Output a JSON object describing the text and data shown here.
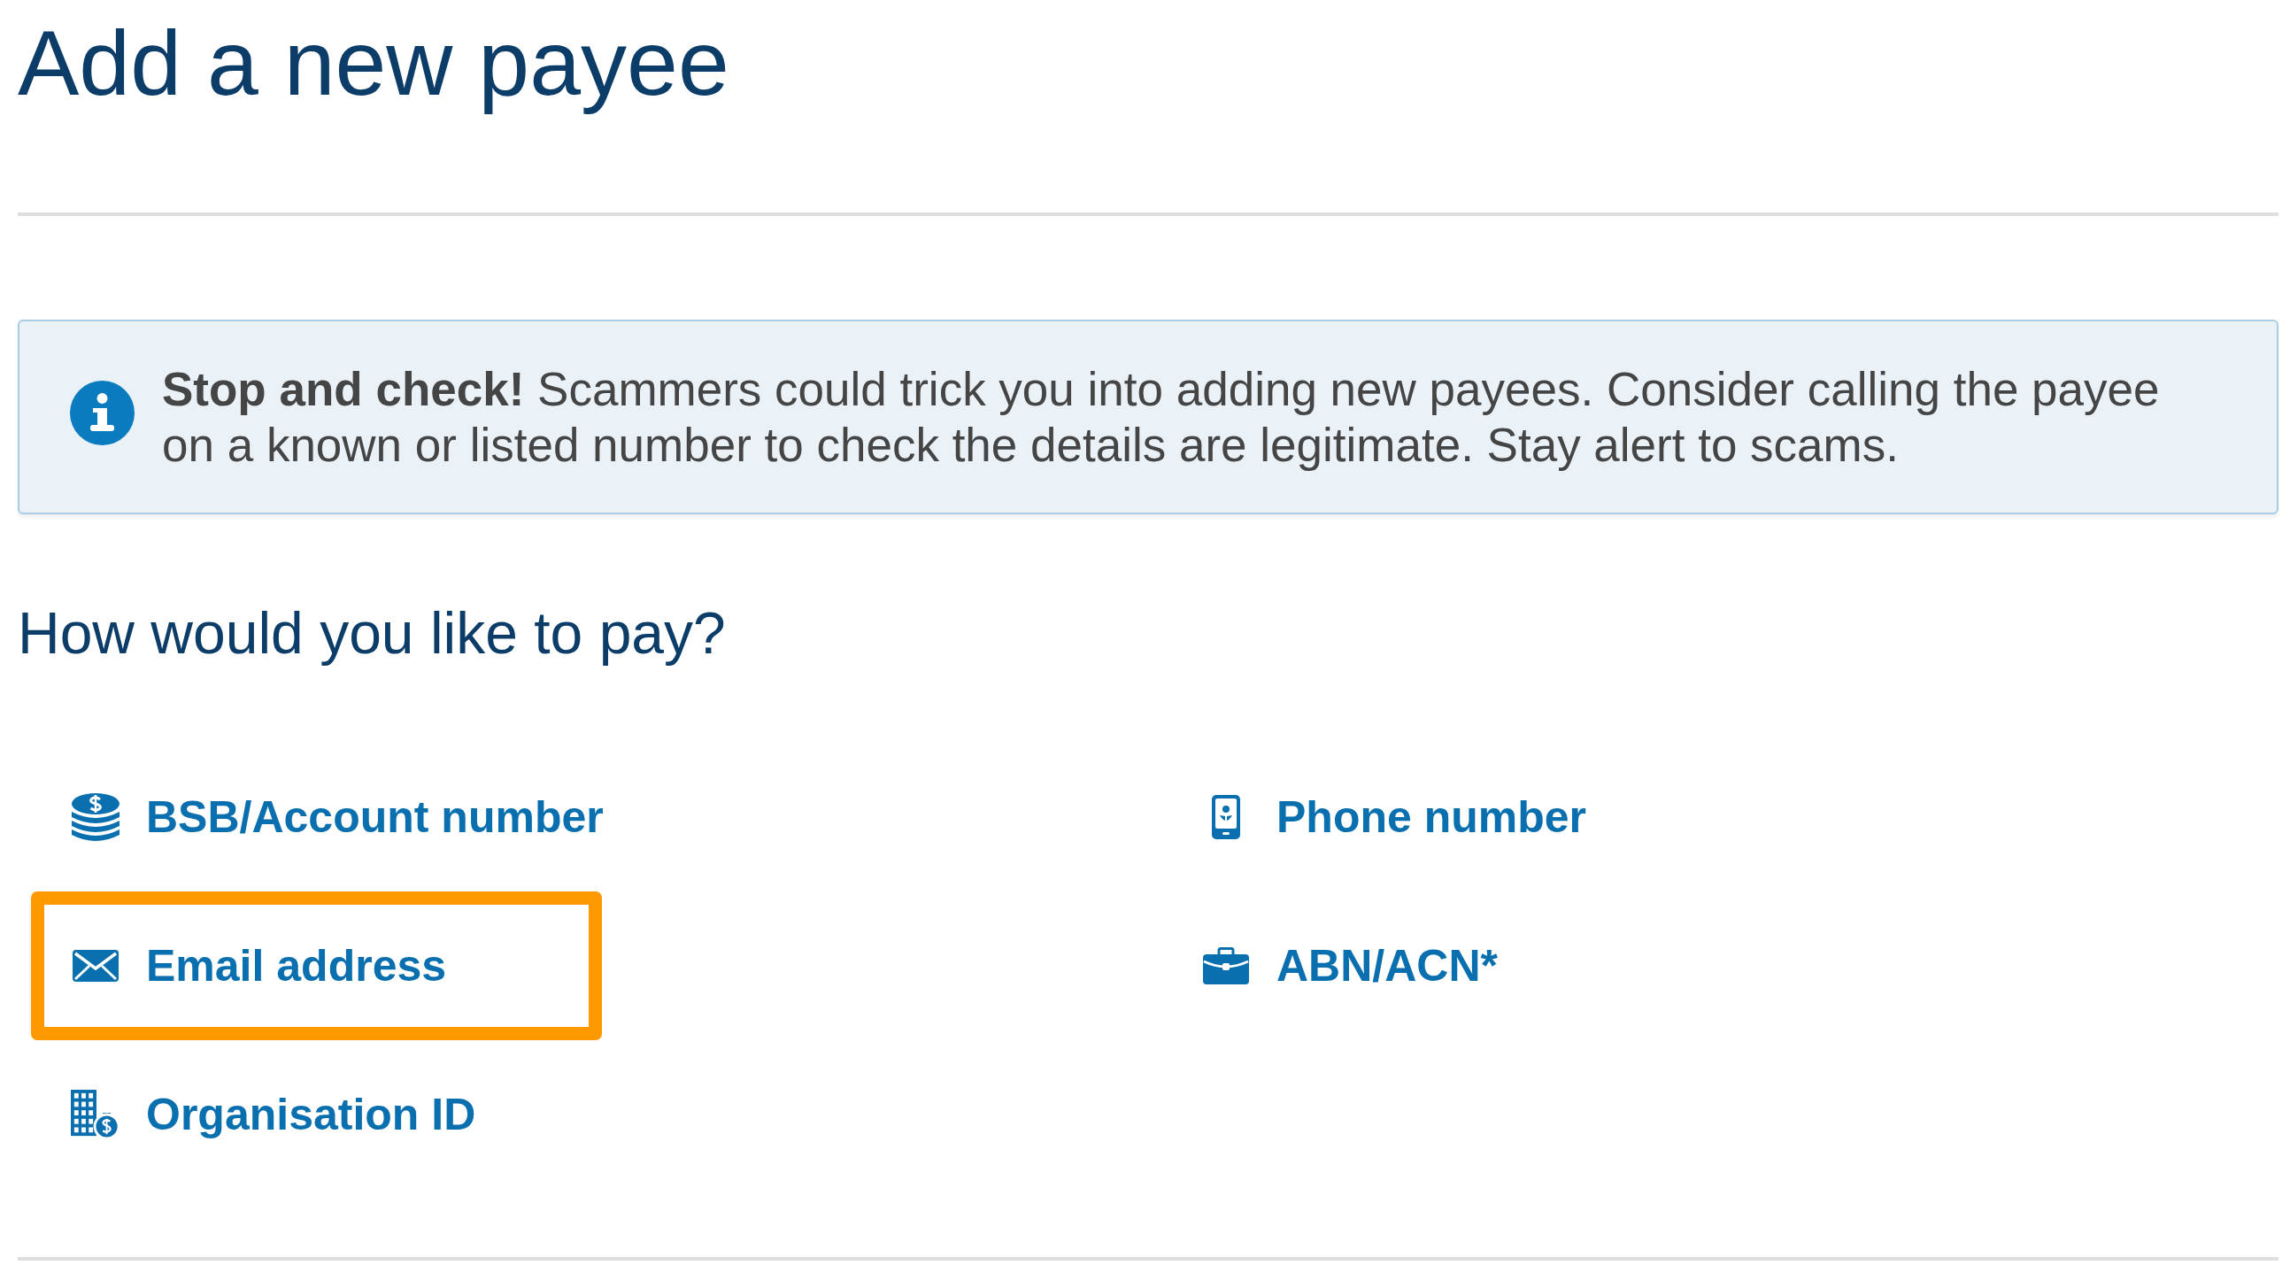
{
  "page": {
    "title": "Add a new payee"
  },
  "alert": {
    "text": "**Stop and check!** Scammers could trick you into adding new payees. Consider calling the payee on a known or listed number to check the details are legitimate. Stay alert to scams."
  },
  "payment_options": {
    "heading": "How would you like to pay?",
    "options": [
      {
        "kind": "account",
        "label": "BSB/Account number",
        "highlighted": false
      },
      {
        "kind": "phone",
        "label": "Phone number",
        "highlighted": false
      },
      {
        "kind": "email",
        "label": "Email address",
        "highlighted": true
      },
      {
        "kind": "business",
        "label": "ABN/ACN*",
        "highlighted": false
      },
      {
        "kind": "organisation",
        "label": "Organisation ID",
        "highlighted": false
      }
    ]
  }
}
